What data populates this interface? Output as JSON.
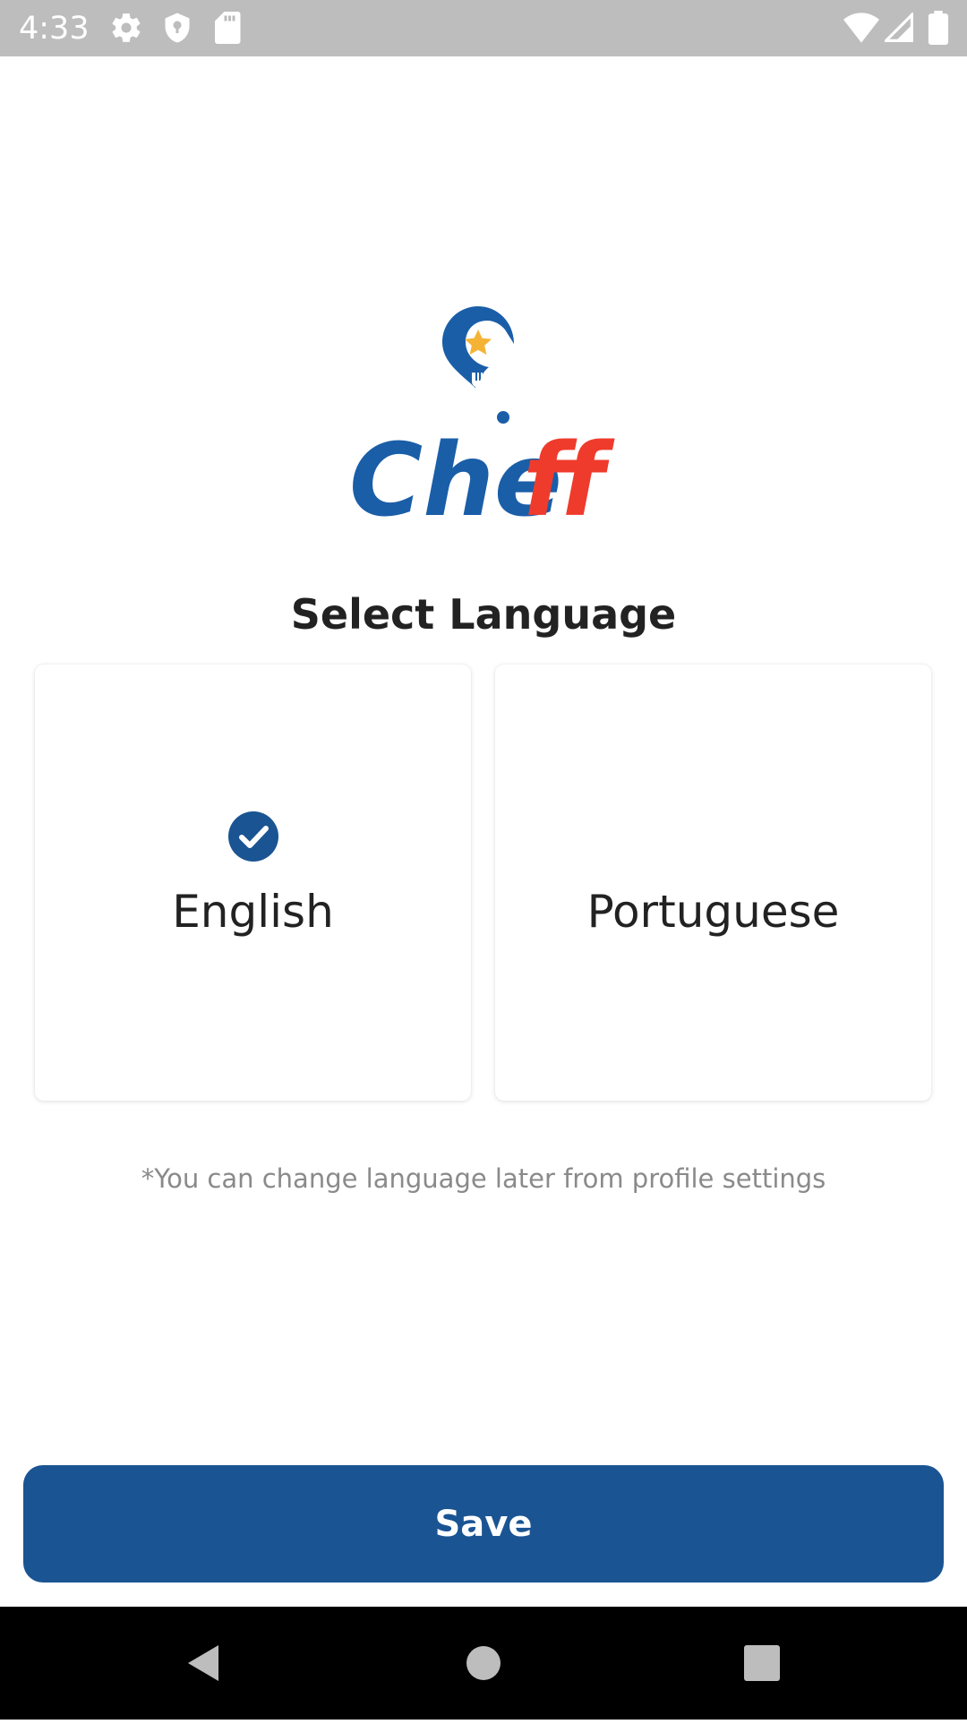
{
  "status_bar": {
    "time": "4:33",
    "icons": [
      "settings-icon",
      "shield-icon",
      "sd-card-icon",
      "wifi-icon",
      "signal-icon",
      "battery-icon"
    ]
  },
  "logo": {
    "text": "Cheff",
    "colors": {
      "blue": "#1a5ea8",
      "red": "#ef3b2c",
      "star": "#f5b335"
    }
  },
  "title": "Select Language",
  "languages": [
    {
      "label": "English",
      "selected": true
    },
    {
      "label": "Portuguese",
      "selected": false
    }
  ],
  "hint": "*You can change language later from profile settings",
  "save_label": "Save",
  "colors": {
    "accent": "#1a5493",
    "status_bar": "#bdbdbd"
  },
  "nav": [
    "back-icon",
    "home-icon",
    "recents-icon"
  ]
}
